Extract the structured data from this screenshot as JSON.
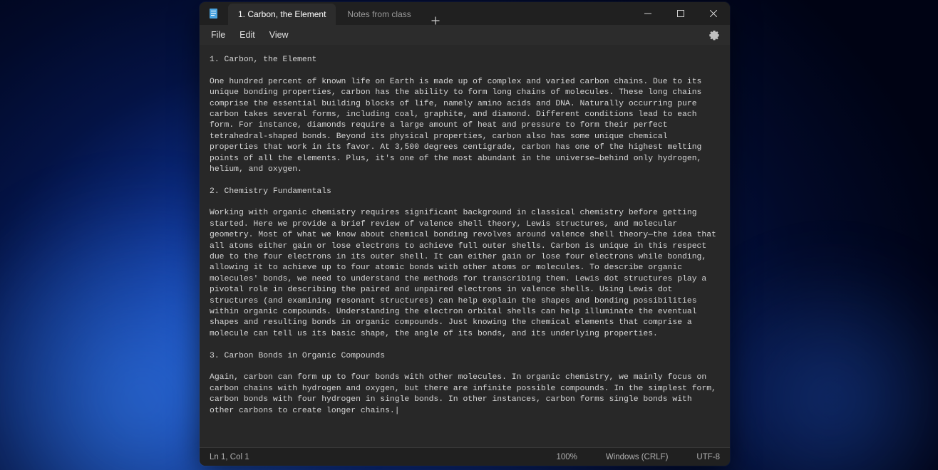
{
  "titlebar": {
    "tabs": [
      {
        "label": "1. Carbon, the Element",
        "active": true
      },
      {
        "label": "Notes from class",
        "active": false
      }
    ]
  },
  "menubar": {
    "file": "File",
    "edit": "Edit",
    "view": "View"
  },
  "document": {
    "text": "1. Carbon, the Element\n\nOne hundred percent of known life on Earth is made up of complex and varied carbon chains. Due to its unique bonding properties, carbon has the ability to form long chains of molecules. These long chains comprise the essential building blocks of life, namely amino acids and DNA. Naturally occurring pure carbon takes several forms, including coal, graphite, and diamond. Different conditions lead to each form. For instance, diamonds require a large amount of heat and pressure to form their perfect tetrahedral-shaped bonds. Beyond its physical properties, carbon also has some unique chemical properties that work in its favor. At 3,500 degrees centigrade, carbon has one of the highest melting points of all the elements. Plus, it's one of the most abundant in the universe—behind only hydrogen, helium, and oxygen.\n\n2. Chemistry Fundamentals\n\nWorking with organic chemistry requires significant background in classical chemistry before getting started. Here we provide a brief review of valence shell theory, Lewis structures, and molecular geometry. Most of what we know about chemical bonding revolves around valence shell theory—the idea that all atoms either gain or lose electrons to achieve full outer shells. Carbon is unique in this respect due to the four electrons in its outer shell. It can either gain or lose four electrons while bonding, allowing it to achieve up to four atomic bonds with other atoms or molecules. To describe organic molecules' bonds, we need to understand the methods for transcribing them. Lewis dot structures play a pivotal role in describing the paired and unpaired electrons in valence shells. Using Lewis dot structures (and examining resonant structures) can help explain the shapes and bonding possibilities within organic compounds. Understanding the electron orbital shells can help illuminate the eventual shapes and resulting bonds in organic compounds. Just knowing the chemical elements that comprise a molecule can tell us its basic shape, the angle of its bonds, and its underlying properties.\n\n3. Carbon Bonds in Organic Compounds\n\nAgain, carbon can form up to four bonds with other molecules. In organic chemistry, we mainly focus on carbon chains with hydrogen and oxygen, but there are infinite possible compounds. In the simplest form, carbon bonds with four hydrogen in single bonds. In other instances, carbon forms single bonds with other carbons to create longer chains.|"
  },
  "statusbar": {
    "position": "Ln 1, Col 1",
    "zoom": "100%",
    "eol": "Windows (CRLF)",
    "encoding": "UTF-8"
  },
  "icons": {
    "app": "notepad-icon",
    "new_tab": "plus-icon",
    "minimize": "minimize-icon",
    "maximize": "maximize-icon",
    "close": "close-icon",
    "settings": "gear-icon"
  }
}
